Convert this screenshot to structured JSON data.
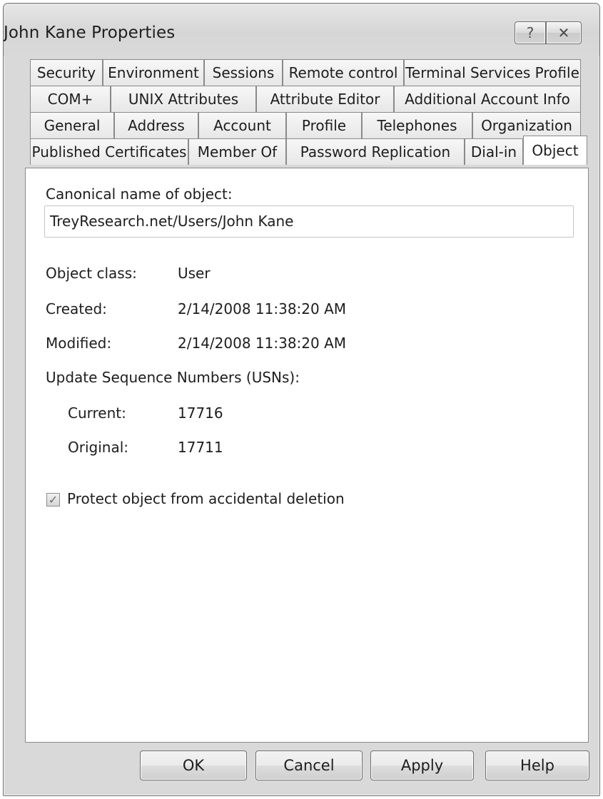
{
  "window": {
    "title": "John Kane Properties",
    "help_glyph": "?",
    "close_glyph": "✕"
  },
  "tabs": {
    "row1": [
      "Security",
      "Environment",
      "Sessions",
      "Remote control",
      "Terminal Services Profile"
    ],
    "row2": [
      "COM+",
      "UNIX Attributes",
      "Attribute Editor",
      "Additional Account Info"
    ],
    "row3": [
      "General",
      "Address",
      "Account",
      "Profile",
      "Telephones",
      "Organization"
    ],
    "row4": [
      "Published Certificates",
      "Member Of",
      "Password Replication",
      "Dial-in",
      "Object"
    ],
    "active": "Object"
  },
  "object_page": {
    "canonical_label": "Canonical name of object:",
    "canonical_value": "TreyResearch.net/Users/John Kane",
    "object_class_label": "Object class:",
    "object_class_value": "User",
    "created_label": "Created:",
    "created_value": "2/14/2008 11:38:20 AM",
    "modified_label": "Modified:",
    "modified_value": "2/14/2008 11:38:20 AM",
    "usn_label": "Update Sequence Numbers (USNs):",
    "current_label": "Current:",
    "current_value": "17716",
    "original_label": "Original:",
    "original_value": "17711",
    "protect_label": "Protect object from accidental deletion",
    "protect_checked": true,
    "check_glyph": "✓"
  },
  "buttons": {
    "ok": "OK",
    "cancel": "Cancel",
    "apply": "Apply",
    "help": "Help"
  }
}
